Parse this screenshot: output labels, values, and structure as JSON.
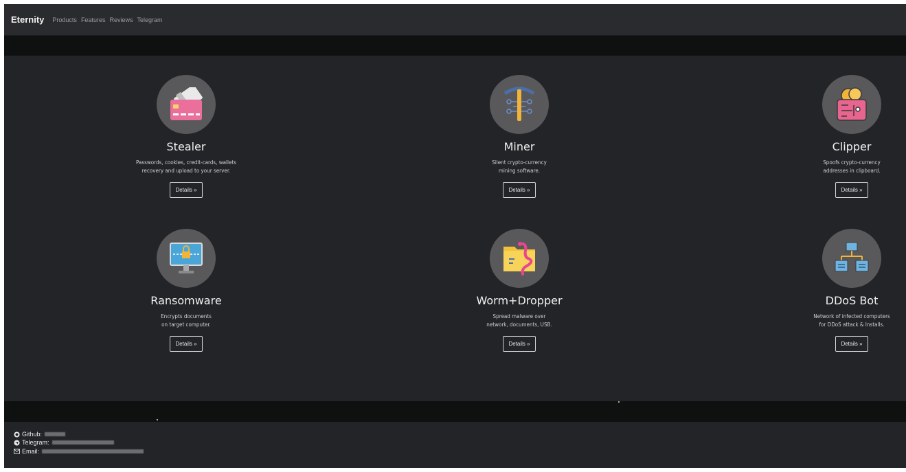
{
  "nav": {
    "brand": "Eternity",
    "links": [
      "Products",
      "Features",
      "Reviews",
      "Telegram"
    ]
  },
  "products": [
    {
      "title": "Stealer",
      "desc": "Passwords, cookies, credit-cards, wallets\nrecovery and upload to your server.",
      "button": "Details »",
      "icon": "credit-card-icon"
    },
    {
      "title": "Miner",
      "desc": "Silent crypto-currency\nmining software.",
      "button": "Details »",
      "icon": "pickaxe-icon"
    },
    {
      "title": "Clipper",
      "desc": "Spoofs crypto-currency\naddresses in clipboard.",
      "button": "Details »",
      "icon": "crypto-wallet-icon"
    },
    {
      "title": "Ransomware",
      "desc": "Encrypts documents\non target computer.",
      "button": "Details »",
      "icon": "locked-monitor-icon"
    },
    {
      "title": "Worm+Dropper",
      "desc": "Spread malware over\nnetwork, documents, USB.",
      "button": "Details »",
      "icon": "worm-folder-icon"
    },
    {
      "title": "DDoS Bot",
      "desc": "Network of infected computers\nfor DDoS attack & Installs.",
      "button": "Details »",
      "icon": "network-servers-icon"
    }
  ],
  "footer": {
    "github_label": "Github:",
    "telegram_label": "Telegram:",
    "email_label": "Email:"
  },
  "colors": {
    "background": "#222428",
    "navbar": "#2a2b2e",
    "icon_circle": "#59595b",
    "text": "#f1f1f1"
  }
}
